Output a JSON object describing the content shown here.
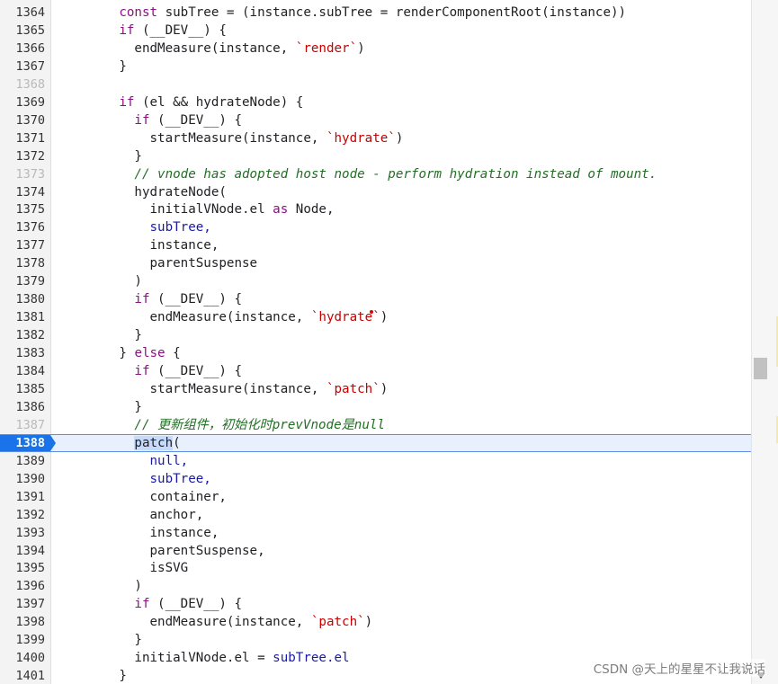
{
  "editor": {
    "active_line": 1388,
    "lines": [
      {
        "n": "1364",
        "ind": "        ",
        "dim": false,
        "tokens": [
          {
            "t": "const ",
            "c": "kw"
          },
          {
            "t": "subTree = (instance.subTree = renderComponentRoot(instance))",
            "c": "id"
          }
        ]
      },
      {
        "n": "1365",
        "ind": "        ",
        "dim": false,
        "tokens": [
          {
            "t": "if",
            "c": "kw"
          },
          {
            "t": " (__DEV__) {",
            "c": "id"
          }
        ]
      },
      {
        "n": "1366",
        "ind": "          ",
        "dim": false,
        "tokens": [
          {
            "t": "endMeasure(instance, ",
            "c": "id"
          },
          {
            "t": "`render`",
            "c": "str"
          },
          {
            "t": ")",
            "c": "id"
          }
        ]
      },
      {
        "n": "1367",
        "ind": "        ",
        "dim": false,
        "tokens": [
          {
            "t": "}",
            "c": "id"
          }
        ]
      },
      {
        "n": "1368",
        "ind": "",
        "dim": true,
        "tokens": []
      },
      {
        "n": "1369",
        "ind": "        ",
        "dim": false,
        "tokens": [
          {
            "t": "if",
            "c": "kw"
          },
          {
            "t": " (el && hydrateNode) {",
            "c": "id"
          }
        ]
      },
      {
        "n": "1370",
        "ind": "          ",
        "dim": false,
        "tokens": [
          {
            "t": "if",
            "c": "kw"
          },
          {
            "t": " (__DEV__) {",
            "c": "id"
          }
        ]
      },
      {
        "n": "1371",
        "ind": "            ",
        "dim": false,
        "tokens": [
          {
            "t": "startMeasure(instance, ",
            "c": "id"
          },
          {
            "t": "`hydrate`",
            "c": "str"
          },
          {
            "t": ")",
            "c": "id"
          }
        ]
      },
      {
        "n": "1372",
        "ind": "          ",
        "dim": false,
        "tokens": [
          {
            "t": "}",
            "c": "id"
          }
        ]
      },
      {
        "n": "1373",
        "ind": "          ",
        "dim": true,
        "tokens": [
          {
            "t": "// vnode has adopted host node - perform hydration instead of mount.",
            "c": "cmt"
          }
        ]
      },
      {
        "n": "1374",
        "ind": "          ",
        "dim": false,
        "tokens": [
          {
            "t": "hydrateNode(",
            "c": "id"
          }
        ]
      },
      {
        "n": "1375",
        "ind": "            ",
        "dim": false,
        "tokens": [
          {
            "t": "initialVNode.el ",
            "c": "id"
          },
          {
            "t": "as",
            "c": "kw"
          },
          {
            "t": " Node,",
            "c": "id"
          }
        ]
      },
      {
        "n": "1376",
        "ind": "            ",
        "dim": false,
        "tokens": [
          {
            "t": "subTree,",
            "c": "blue"
          }
        ]
      },
      {
        "n": "1377",
        "ind": "            ",
        "dim": false,
        "tokens": [
          {
            "t": "instance,",
            "c": "id"
          }
        ]
      },
      {
        "n": "1378",
        "ind": "            ",
        "dim": false,
        "tokens": [
          {
            "t": "parentSuspense",
            "c": "id"
          }
        ]
      },
      {
        "n": "1379",
        "ind": "          ",
        "dim": false,
        "tokens": [
          {
            "t": ")",
            "c": "id"
          }
        ]
      },
      {
        "n": "1380",
        "ind": "          ",
        "dim": false,
        "tokens": [
          {
            "t": "if",
            "c": "kw"
          },
          {
            "t": " (__DEV__) {",
            "c": "id"
          }
        ]
      },
      {
        "n": "1381",
        "ind": "            ",
        "dim": false,
        "tokens": [
          {
            "t": "endMeasure(instance, ",
            "c": "id"
          },
          {
            "t": "`hydrate",
            "c": "str"
          },
          {
            "t": "",
            "c": "dot"
          },
          {
            "t": "`",
            "c": "str"
          },
          {
            "t": ")",
            "c": "id"
          }
        ]
      },
      {
        "n": "1382",
        "ind": "          ",
        "dim": false,
        "tokens": [
          {
            "t": "}",
            "c": "id"
          }
        ]
      },
      {
        "n": "1383",
        "ind": "        ",
        "dim": false,
        "tokens": [
          {
            "t": "} ",
            "c": "id"
          },
          {
            "t": "else",
            "c": "kw"
          },
          {
            "t": " {",
            "c": "id"
          }
        ]
      },
      {
        "n": "1384",
        "ind": "          ",
        "dim": false,
        "tokens": [
          {
            "t": "if",
            "c": "kw"
          },
          {
            "t": " (__DEV__) {",
            "c": "id"
          }
        ]
      },
      {
        "n": "1385",
        "ind": "            ",
        "dim": false,
        "tokens": [
          {
            "t": "startMeasure(instance, ",
            "c": "id"
          },
          {
            "t": "`patch`",
            "c": "str"
          },
          {
            "t": ")",
            "c": "id"
          }
        ]
      },
      {
        "n": "1386",
        "ind": "          ",
        "dim": false,
        "tokens": [
          {
            "t": "}",
            "c": "id"
          }
        ]
      },
      {
        "n": "1387",
        "ind": "          ",
        "dim": true,
        "tokens": [
          {
            "t": "// 更新组件，初始化时prevVnode是null",
            "c": "cmt2"
          }
        ]
      },
      {
        "n": "1388",
        "ind": "          ",
        "dim": false,
        "tokens": [
          {
            "t": "patch",
            "c": "hl"
          },
          {
            "t": "(",
            "c": "id"
          }
        ]
      },
      {
        "n": "1389",
        "ind": "            ",
        "dim": false,
        "tokens": [
          {
            "t": "null,",
            "c": "blue"
          }
        ]
      },
      {
        "n": "1390",
        "ind": "            ",
        "dim": false,
        "tokens": [
          {
            "t": "subTree,",
            "c": "blue"
          }
        ]
      },
      {
        "n": "1391",
        "ind": "            ",
        "dim": false,
        "tokens": [
          {
            "t": "container,",
            "c": "id"
          }
        ]
      },
      {
        "n": "1392",
        "ind": "            ",
        "dim": false,
        "tokens": [
          {
            "t": "anchor,",
            "c": "id"
          }
        ]
      },
      {
        "n": "1393",
        "ind": "            ",
        "dim": false,
        "tokens": [
          {
            "t": "instance,",
            "c": "id"
          }
        ]
      },
      {
        "n": "1394",
        "ind": "            ",
        "dim": false,
        "tokens": [
          {
            "t": "parentSuspense,",
            "c": "id"
          }
        ]
      },
      {
        "n": "1395",
        "ind": "            ",
        "dim": false,
        "tokens": [
          {
            "t": "isSVG",
            "c": "id"
          }
        ]
      },
      {
        "n": "1396",
        "ind": "          ",
        "dim": false,
        "tokens": [
          {
            "t": ")",
            "c": "id"
          }
        ]
      },
      {
        "n": "1397",
        "ind": "          ",
        "dim": false,
        "tokens": [
          {
            "t": "if",
            "c": "kw"
          },
          {
            "t": " (__DEV__) {",
            "c": "id"
          }
        ]
      },
      {
        "n": "1398",
        "ind": "            ",
        "dim": false,
        "tokens": [
          {
            "t": "endMeasure(instance, ",
            "c": "id"
          },
          {
            "t": "`patch`",
            "c": "str"
          },
          {
            "t": ")",
            "c": "id"
          }
        ]
      },
      {
        "n": "1399",
        "ind": "          ",
        "dim": false,
        "tokens": [
          {
            "t": "}",
            "c": "id"
          }
        ]
      },
      {
        "n": "1400",
        "ind": "          ",
        "dim": false,
        "tokens": [
          {
            "t": "initialVNode.el = ",
            "c": "id"
          },
          {
            "t": "subTree.el",
            "c": "blue"
          }
        ]
      },
      {
        "n": "1401",
        "ind": "        ",
        "dim": false,
        "tokens": [
          {
            "t": "}",
            "c": "id"
          }
        ]
      }
    ]
  },
  "watermark": "CSDN @天上的星星不让我说话",
  "colors": {
    "active_line_bg": "#e8f0fe",
    "active_gutter": "#1a73e8",
    "keyword": "#881280",
    "string": "#c80000",
    "comment": "#236e25"
  }
}
